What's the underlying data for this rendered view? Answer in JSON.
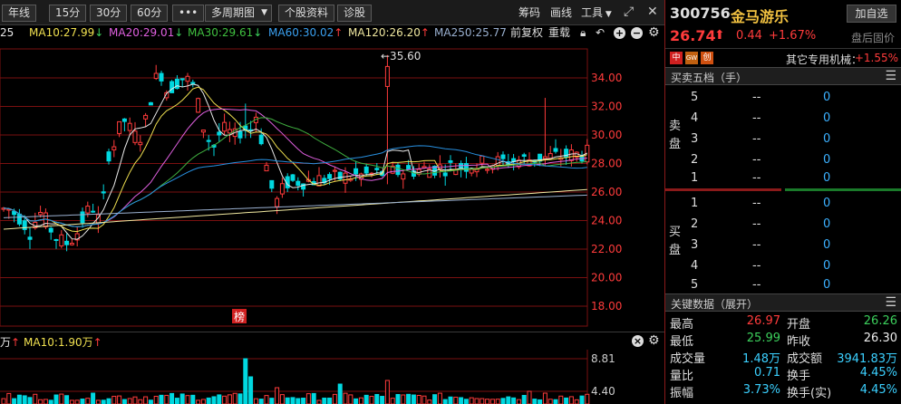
{
  "toolbar": {
    "btn_annual": "年线",
    "btn_15m": "15分",
    "btn_30m": "30分",
    "btn_60m": "60分",
    "btn_more": "•••",
    "btn_multiperiod": "多周期图",
    "btn_profile": "个股资料",
    "btn_diagnose": "诊股",
    "link_chips": "筹码",
    "link_draw": "画线",
    "link_tools": "工具"
  },
  "ma_legend": {
    "ma5": "25",
    "ma10": "MA10:27.99",
    "ma20": "MA20:29.01",
    "ma30": "MA30:29.61",
    "ma60": "MA60:30.02",
    "ma120": "MA120:26.20",
    "ma250": "MA250:25.77",
    "adjust": "前复权",
    "redraw": "重载"
  },
  "colors": {
    "up": "#ff3b3b",
    "down": "#00d8e0",
    "ma5": "#e8e8e8",
    "ma10": "#f0e050",
    "ma20": "#e060e0",
    "ma30": "#40b040",
    "ma60": "#2890e0",
    "ma120": "#f0e8a0",
    "ma250": "#9ab0d0",
    "grid": "#7a1010"
  },
  "chart_data": {
    "type": "candlestick",
    "y_ticks": [
      "34.00",
      "32.00",
      "30.00",
      "28.00",
      "26.00",
      "24.00",
      "22.00",
      "20.00",
      "18.00"
    ],
    "ylim": [
      17,
      37
    ],
    "peak_annotation": "35.60",
    "marker_label": "榜",
    "volume_legend": {
      "vol_unit": "万",
      "ma10": "MA10:1.90万"
    },
    "volume_ticks": [
      "8.81",
      "4.40"
    ]
  },
  "quote": {
    "code": "300756",
    "name": "金马游乐",
    "add_watch": "加自选",
    "price": "26.74",
    "change": "0.44",
    "change_pct": "+1.67%",
    "after_hours": "盘后固价",
    "flags": [
      "中",
      "GW",
      "创"
    ],
    "inst_label": "其它专用机械：",
    "inst_value": "+1.55%"
  },
  "orderbook": {
    "title": "买卖五档（手）",
    "sell_side_label": [
      "卖",
      "盘"
    ],
    "buy_side_label": [
      "买",
      "盘"
    ],
    "sell": [
      {
        "level": "5",
        "price": "--",
        "qty": "0"
      },
      {
        "level": "4",
        "price": "--",
        "qty": "0"
      },
      {
        "level": "3",
        "price": "--",
        "qty": "0"
      },
      {
        "level": "2",
        "price": "--",
        "qty": "0"
      },
      {
        "level": "1",
        "price": "--",
        "qty": "0"
      }
    ],
    "buy": [
      {
        "level": "1",
        "price": "--",
        "qty": "0"
      },
      {
        "level": "2",
        "price": "--",
        "qty": "0"
      },
      {
        "level": "3",
        "price": "--",
        "qty": "0"
      },
      {
        "level": "4",
        "price": "--",
        "qty": "0"
      },
      {
        "level": "5",
        "price": "--",
        "qty": "0"
      }
    ]
  },
  "keydata": {
    "title": "关键数据（展开）",
    "rows": [
      {
        "l": "最高",
        "lv": "26.97",
        "r": "开盘",
        "rv": "26.26"
      },
      {
        "l": "最低",
        "lv": "25.99",
        "r": "昨收",
        "rv": "26.30"
      },
      {
        "l": "成交量",
        "lv": "1.48万",
        "r": "成交额",
        "rv": "3941.83万"
      },
      {
        "l": "量比",
        "lv": "0.71",
        "r": "换手",
        "rv": "4.45%"
      },
      {
        "l": "振幅",
        "lv": "3.73%",
        "r": "换手(实)",
        "rv": "4.45%"
      }
    ]
  }
}
